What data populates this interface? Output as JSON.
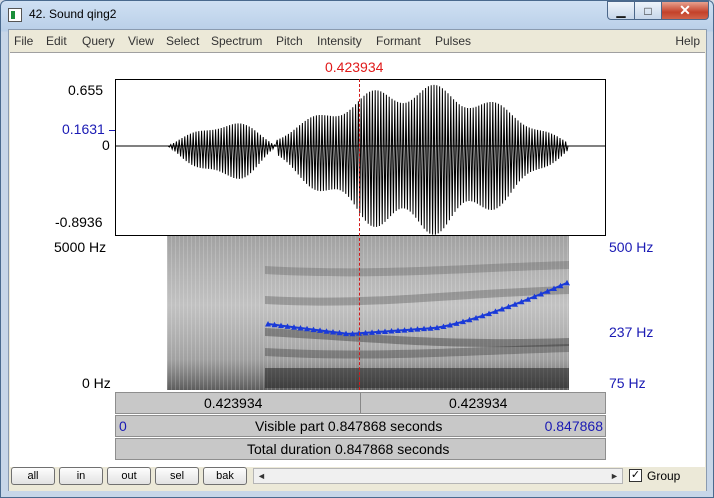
{
  "window": {
    "title": "42. Sound qing2",
    "min_glyph": "▁",
    "max_glyph": "□",
    "close_glyph": "✕"
  },
  "menu": [
    "File",
    "Edit",
    "Query",
    "View",
    "Select",
    "Spectrum",
    "Pitch",
    "Intensity",
    "Formant",
    "Pulses"
  ],
  "menu_help": "Help",
  "cursor": {
    "time_label": "0.423934"
  },
  "waveform": {
    "y_max": "0.655",
    "y_cursor": "0.1631",
    "y_zero": "0",
    "y_min": "-0.8936"
  },
  "spectrogram": {
    "freq_top": "5000 Hz",
    "freq_bottom": "0 Hz"
  },
  "pitch": {
    "top": "500 Hz",
    "mid": "237 Hz",
    "bottom": "75 Hz"
  },
  "bars": {
    "left_time": "0.423934",
    "right_time": "0.423934",
    "visible_start": "0",
    "visible_text": "Visible part 0.847868 seconds",
    "visible_end": "0.847868",
    "total_text": "Total duration 0.847868 seconds"
  },
  "buttons": [
    "all",
    "in",
    "out",
    "sel",
    "bak"
  ],
  "scroll": {
    "left": "◄",
    "right": "►"
  },
  "group": {
    "label": "Group",
    "checked": true,
    "check_glyph": "✓"
  },
  "colors": {
    "cursor": "#e01a1a",
    "pitch": "#1a3ad8",
    "axis_blue": "#1a1ab4"
  }
}
